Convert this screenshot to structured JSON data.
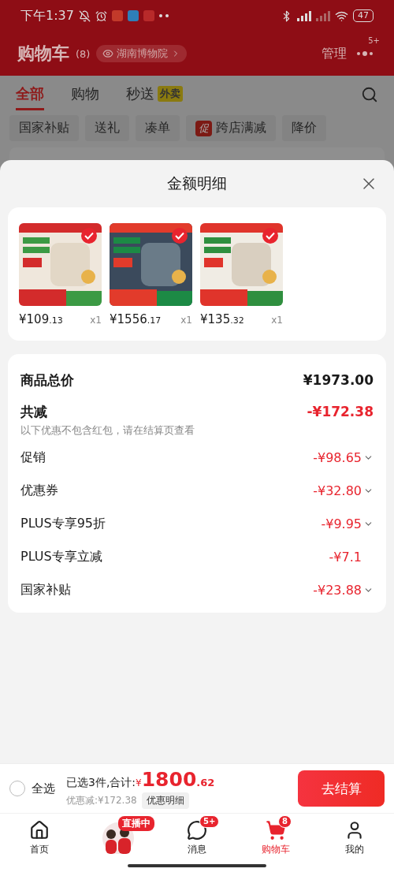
{
  "status_bar": {
    "time": "下午1:37",
    "battery": "47"
  },
  "header": {
    "title": "购物车",
    "count": "(8)",
    "location": "湖南博物院",
    "manage": "管理",
    "more_badge": "5+"
  },
  "tabs": [
    {
      "label": "全部",
      "selected": true
    },
    {
      "label": "购物",
      "selected": false
    },
    {
      "label": "秒送",
      "selected": false,
      "badge": "外卖"
    }
  ],
  "filters": [
    {
      "label": "国家补贴"
    },
    {
      "label": "送礼"
    },
    {
      "label": "凑单"
    },
    {
      "label": "跨店满减",
      "tag": "促"
    },
    {
      "label": "降价"
    }
  ],
  "sheet": {
    "title": "金额明细",
    "products": [
      {
        "price": "¥109",
        "cents": ".13",
        "qty": "x1",
        "checked": true
      },
      {
        "price": "¥1556",
        "cents": ".17",
        "qty": "x1",
        "checked": true
      },
      {
        "price": "¥135",
        "cents": ".32",
        "qty": "x1",
        "checked": true
      }
    ],
    "total_label": "商品总价",
    "total_value": "¥1973.00",
    "reduce_label": "共减",
    "reduce_value": "-¥172.38",
    "note": "以下优惠不包含红包，请在结算页查看",
    "items": [
      {
        "label": "促销",
        "value": "-¥98.65",
        "expandable": true
      },
      {
        "label": "优惠券",
        "value": "-¥32.80",
        "expandable": true
      },
      {
        "label": "PLUS专享95折",
        "value": "-¥9.95",
        "expandable": true
      },
      {
        "label": "PLUS专享立减",
        "value": "-¥7.1",
        "expandable": false
      },
      {
        "label": "国家补贴",
        "value": "-¥23.88",
        "expandable": true
      }
    ]
  },
  "checkout": {
    "select_all": "全选",
    "checked": false,
    "summary": "已选3件,合计:",
    "currency": "¥",
    "amount": "1800",
    "cents": ".62",
    "discount": "优惠减:¥172.38",
    "detail": "优惠明细",
    "button": "去结算"
  },
  "nav": [
    {
      "kind": "home",
      "label": "首页",
      "selected": false
    },
    {
      "kind": "live",
      "badge": "直播中",
      "selected": false
    },
    {
      "kind": "message",
      "label": "消息",
      "badge": "5+",
      "selected": false
    },
    {
      "kind": "cart",
      "label": "购物车",
      "badge": "8",
      "selected": true
    },
    {
      "kind": "user",
      "label": "我的",
      "selected": false
    }
  ]
}
